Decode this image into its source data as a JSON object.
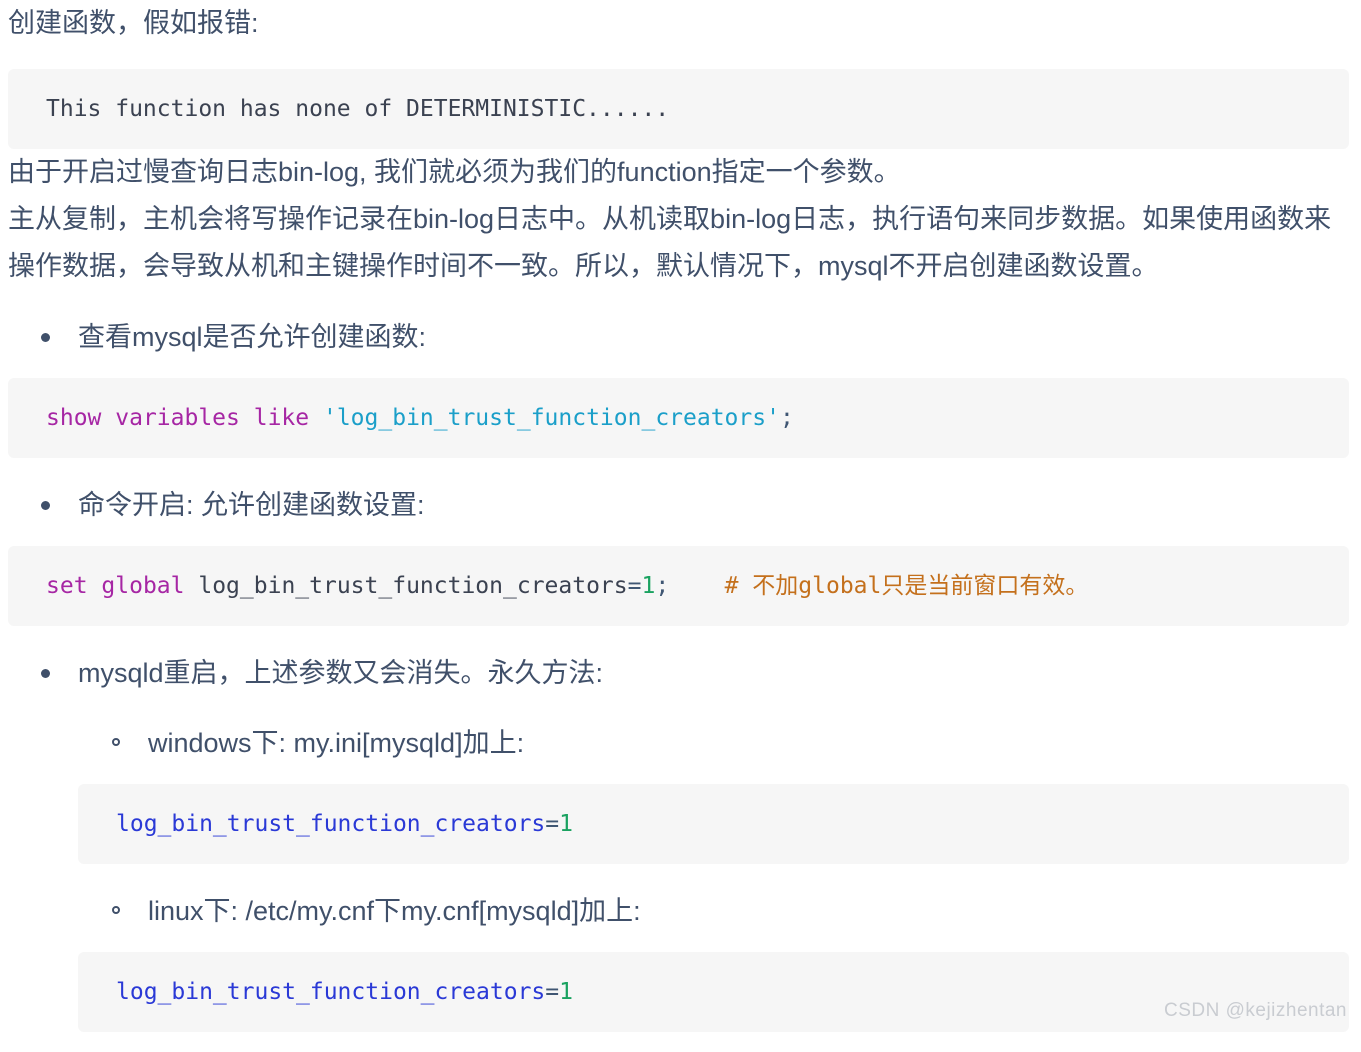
{
  "article": {
    "intro_title": "创建函数，假如报错:",
    "error_code": "This function has none of DETERMINISTIC......",
    "paragraph_1": "由于开启过慢查询日志bin-log, 我们就必须为我们的function指定一个参数。",
    "paragraph_2": "主从复制，主机会将写操作记录在bin-log日志中。从机读取bin-log日志，执行语句来同步数据。如果使用函数来操作数据，会导致从机和主键操作时间不一致。所以，默认情况下，mysql不开启创建函数设置。",
    "bullets": [
      {
        "label": "查看mysql是否允许创建函数:"
      },
      {
        "label": "命令开启: 允许创建函数设置:"
      },
      {
        "label": "mysqld重启，上述参数又会消失。永久方法:"
      }
    ],
    "sub_bullets": [
      {
        "label": "windows下: my.ini[mysqld]加上:"
      },
      {
        "label": "linux下: /etc/my.cnf下my.cnf[mysqld]加上:"
      }
    ],
    "code_show_variables": {
      "keyword_show": "show",
      "keyword_variables": "variables",
      "keyword_like": "like",
      "string_value": "'log_bin_trust_function_creators'",
      "semicolon": ";"
    },
    "code_set_global": {
      "keyword_set": "set",
      "keyword_global": "global",
      "identifier": "log_bin_trust_function_creators",
      "operator": "=",
      "number": "1",
      "semicolon": ";",
      "spacer": "    ",
      "comment": "# 不加global只是当前窗口有效。"
    },
    "code_ini_windows": {
      "key": "log_bin_trust_function_creators",
      "operator": "=",
      "value": "1"
    },
    "code_ini_linux": {
      "key": "log_bin_trust_function_creators",
      "operator": "=",
      "value": "1"
    }
  },
  "watermark": {
    "text": "CSDN @kejizhentan"
  },
  "colors": {
    "text": "#40506a",
    "code_bg": "#f6f6f6",
    "keyword": "#a626a4",
    "string": "#1b9fc9",
    "number": "#1aa260",
    "comment": "#c4701c",
    "variable": "#2a39d6",
    "watermark": "#c9ccd1"
  }
}
